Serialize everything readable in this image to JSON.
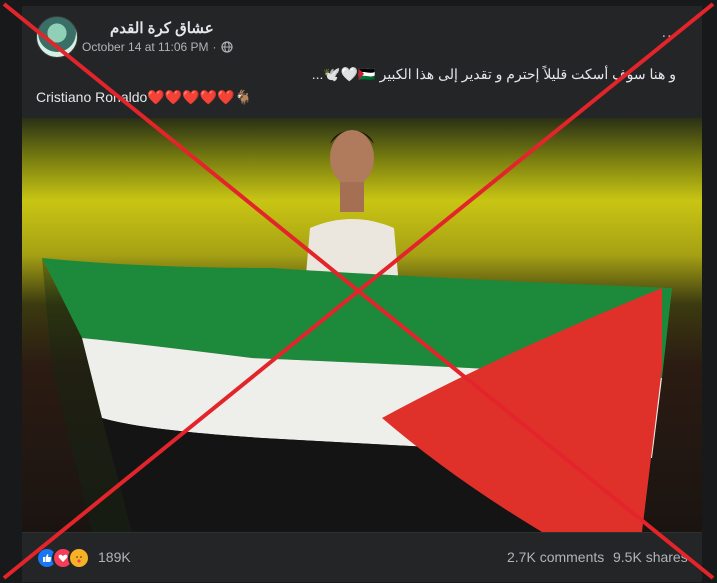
{
  "post": {
    "page_name": "عشاق كرة القدم",
    "timestamp": "October 14 at 11:06 PM",
    "audience_separator": "·",
    "more_label": "...",
    "text_arabic": "و هنا سوف أسكت قليلاً إحترم و تقدير إلى هذا الكبير 🇵🇸🤍🕊️...",
    "text_english": "Cristiano Ronaldo❤️❤️❤️❤️❤️🐐"
  },
  "engagement": {
    "reactions_count": "189K",
    "comments": "2.7K comments",
    "shares": "9.5K shares"
  },
  "icons": {
    "globe": "globe-icon",
    "like": "like-reaction-icon",
    "love": "love-reaction-icon",
    "care": "care-reaction-icon"
  },
  "colors": {
    "background": "#18191a",
    "card": "#242526",
    "text_primary": "#e4e6eb",
    "text_secondary": "#b0b3b8",
    "cross": "#e3252b",
    "flag_green": "#1d8a3b",
    "flag_red": "#e0302a"
  }
}
